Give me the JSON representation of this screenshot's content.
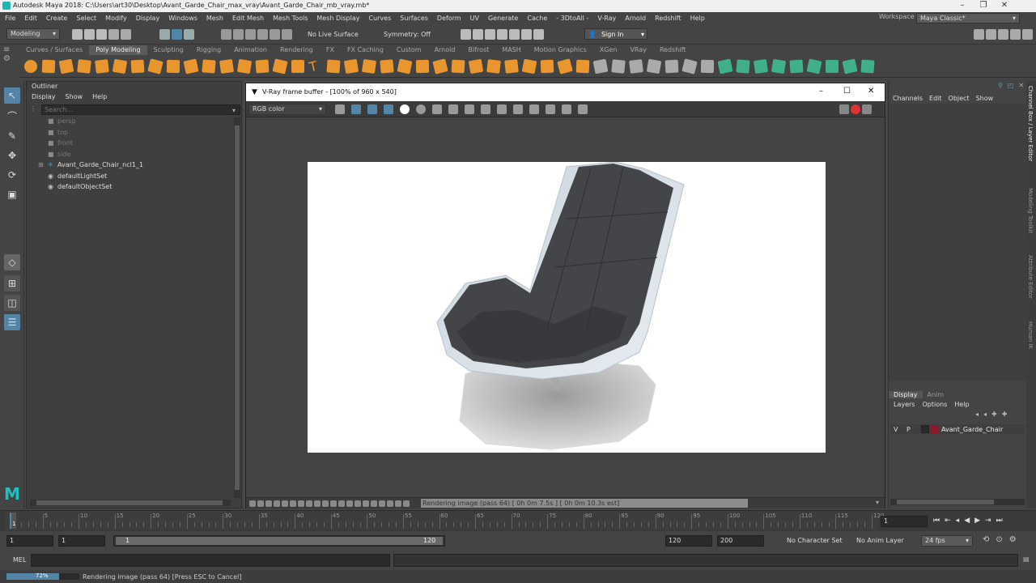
{
  "window": {
    "title": "Autodesk Maya 2018: C:\\Users\\art30\\Desktop\\Avant_Garde_Chair_max_vray\\Avant_Garde_Chair_mb_vray.mb*"
  },
  "menu": [
    "File",
    "Edit",
    "Create",
    "Select",
    "Modify",
    "Display",
    "Windows",
    "Mesh",
    "Edit Mesh",
    "Mesh Tools",
    "Mesh Display",
    "Curves",
    "Surfaces",
    "Deform",
    "UV",
    "Generate",
    "Cache",
    "- 3DtoAll -",
    "V-Ray",
    "Arnold",
    "Redshift",
    "Help"
  ],
  "workspace": {
    "label": "Workspace :",
    "value": "Maya Classic*"
  },
  "statusline": {
    "mode": "Modeling",
    "live_surface": "No Live Surface",
    "symmetry": "Symmetry: Off",
    "sign_in": "Sign In"
  },
  "shelf_tabs": [
    "Curves / Surfaces",
    "Poly Modeling",
    "Sculpting",
    "Rigging",
    "Animation",
    "Rendering",
    "FX",
    "FX Caching",
    "Custom",
    "Arnold",
    "Bifrost",
    "MASH",
    "Motion Graphics",
    "XGen",
    "VRay",
    "Redshift"
  ],
  "shelf_active": "Poly Modeling",
  "outliner": {
    "title": "Outliner",
    "menu": [
      "Display",
      "Show",
      "Help"
    ],
    "search_placeholder": "Search...",
    "items": [
      {
        "label": "persp",
        "dim": true,
        "indent": 1
      },
      {
        "label": "top",
        "dim": true,
        "indent": 1
      },
      {
        "label": "front",
        "dim": true,
        "indent": 1
      },
      {
        "label": "side",
        "dim": true,
        "indent": 1
      },
      {
        "label": "Avant_Garde_Chair_ncl1_1",
        "dim": false,
        "indent": 0
      },
      {
        "label": "defaultLightSet",
        "dim": false,
        "indent": 1
      },
      {
        "label": "defaultObjectSet",
        "dim": false,
        "indent": 1
      }
    ]
  },
  "vfb": {
    "title": "V-Ray frame buffer - [100% of 960 x 540]",
    "channel": "RGB color",
    "status": "Rendering image (pass 64) [ 0h  0m  7.5s ] [ 0h  0m 10.3s est]"
  },
  "channelbox": {
    "menu": [
      "Channels",
      "Edit",
      "Object",
      "Show"
    ]
  },
  "layers": {
    "tabs": [
      "Display",
      "Anim"
    ],
    "menu": [
      "Layers",
      "Options",
      "Help"
    ],
    "row": {
      "v": "V",
      "p": "P",
      "name": "Avant_Garde_Chair",
      "color": "#8b1a2a"
    }
  },
  "side_tabs": [
    "Channel Box / Layer Editor",
    "Modeling Toolkit",
    "Attribute Editor",
    "Human IK"
  ],
  "timeline": {
    "ticks": [
      "1",
      "5",
      "10",
      "15",
      "20",
      "25",
      "30",
      "35",
      "40",
      "45",
      "50",
      "55",
      "60",
      "65",
      "70",
      "75",
      "80",
      "85",
      "90",
      "95",
      "100",
      "105",
      "110",
      "115",
      "120"
    ],
    "current": "1"
  },
  "range": {
    "start": "1",
    "inner_start": "1",
    "slider_start": "1",
    "slider_end": "120",
    "end": "120",
    "outer_end": "200",
    "character_set": "No Character Set",
    "anim_layer": "No Anim Layer",
    "fps": "24 fps"
  },
  "mel": {
    "label": "MEL"
  },
  "helpline": {
    "progress": "72%",
    "progress_value": 0.72,
    "text": "Rendering image (pass 64) [Press ESC to Cancel]"
  },
  "colors": {
    "accent": "#5285a6",
    "shelf_icon": "#e8962d",
    "shelf_green": "#3fb08a",
    "maya_logo": "#20c0c0"
  }
}
